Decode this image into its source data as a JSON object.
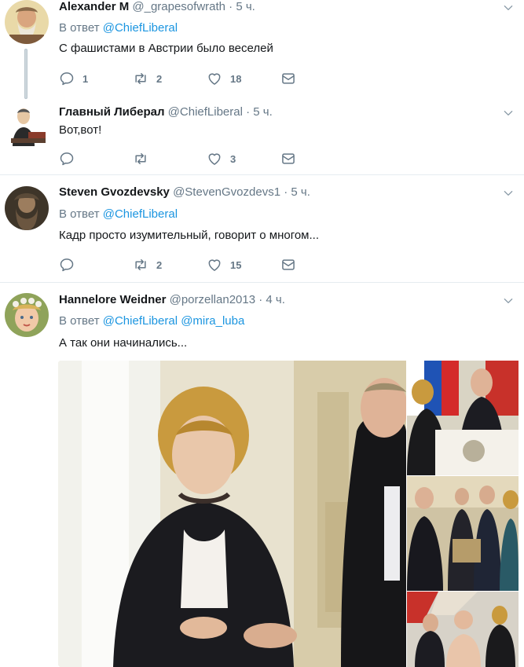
{
  "tweets": [
    {
      "fullname": "Alexander M",
      "username": "@_grapesofwrath",
      "time": "5 ч.",
      "reply_prefix": "В ответ",
      "reply_to": "@ChiefLiberal",
      "text": "С фашистами в Австрии было веселей",
      "replies": "1",
      "retweets": "2",
      "likes": "18"
    },
    {
      "fullname": "Главный Либерал",
      "username": "@ChiefLiberal",
      "time": "5 ч.",
      "text": "Вот,вот!",
      "replies": "",
      "retweets": "",
      "likes": "3"
    },
    {
      "fullname": "Steven Gvozdevsky",
      "username": "@StevenGvozdevs1",
      "time": "5 ч.",
      "reply_prefix": "В ответ",
      "reply_to": "@ChiefLiberal",
      "text": "Кадр просто изумительный, говорит о многом...",
      "replies": "",
      "retweets": "2",
      "likes": "15"
    },
    {
      "fullname": "Hannelore Weidner",
      "username": "@porzellan2013",
      "time": "4 ч.",
      "reply_prefix": "В ответ",
      "reply_to": "@ChiefLiberal",
      "reply_to_2": "@mira_luba",
      "text": "А так они начинались...",
      "replies": "",
      "retweets": "",
      "likes": ""
    }
  ],
  "separator_dot": "·",
  "icons": {
    "reply": "reply-icon",
    "retweet": "retweet-icon",
    "like": "heart-icon",
    "dm": "envelope-icon",
    "caret": "chevron-down-icon"
  },
  "colors": {
    "secondary_text": "#657786",
    "link": "#1b95e0",
    "separator": "#e6ecf0"
  }
}
